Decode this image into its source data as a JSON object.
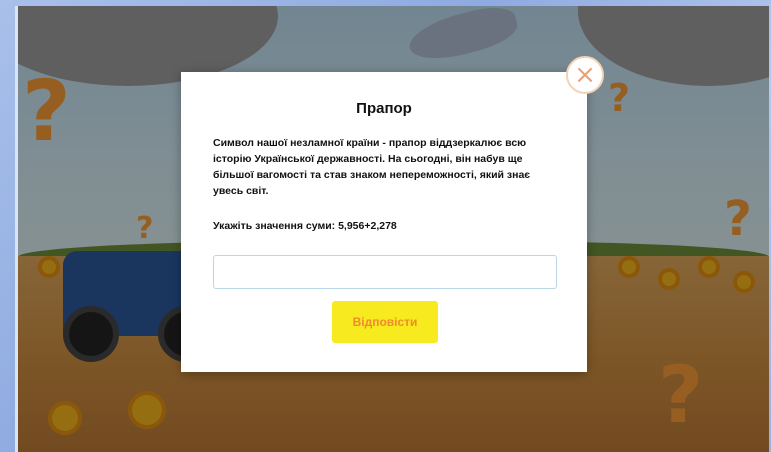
{
  "dialog": {
    "title": "Прапор",
    "text": "Символ нашої незламної країни - прапор віддзеркалює всю історію Української державності. На сьогодні, він набув ще більшої вагомості та став знаком непереможності, який знає увесь світ.",
    "task": "Укажіть значення суми: 5,956+2,278",
    "answer_value": "",
    "submit_label": "Відповісти",
    "close_glyph": "×"
  },
  "decor": {
    "question_mark": "?",
    "accent_color": "#f39a36",
    "button_color": "#f7ea1f",
    "button_text_color": "#f08a2e"
  }
}
